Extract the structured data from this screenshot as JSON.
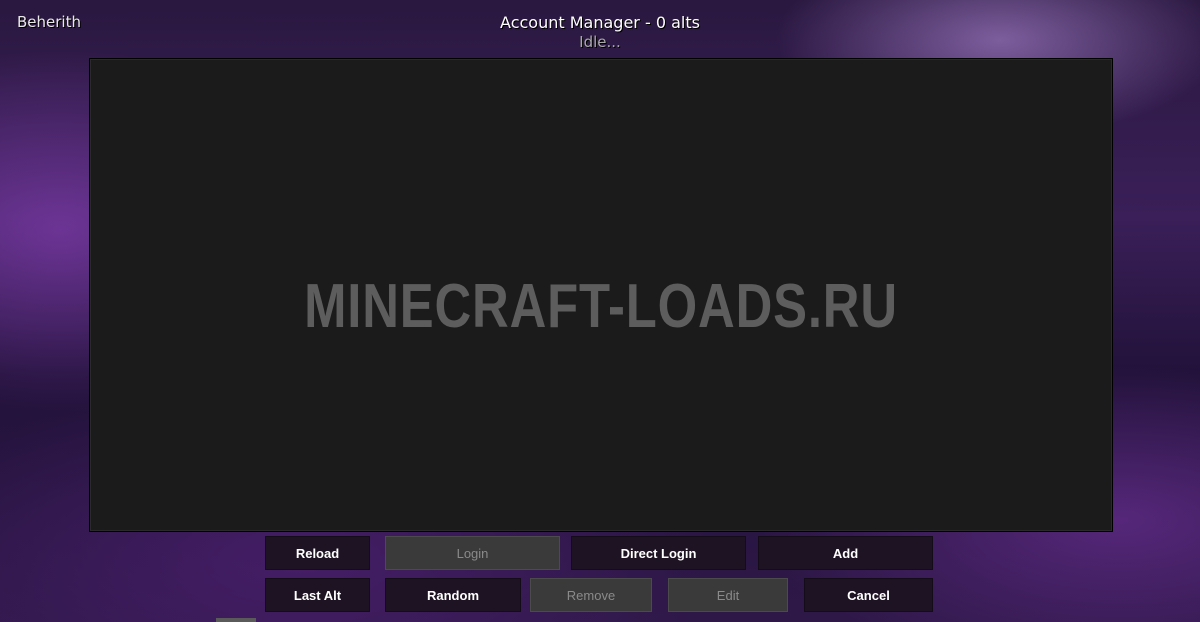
{
  "client_name": "Beherith",
  "header": {
    "title": "Account Manager - 0 alts",
    "status": "Idle..."
  },
  "watermark": "MINECRAFT-LOADS.RU",
  "buttons": {
    "reload": "Reload",
    "login": "Login",
    "direct_login": "Direct Login",
    "add": "Add",
    "last_alt": "Last Alt",
    "random": "Random",
    "remove": "Remove",
    "edit": "Edit",
    "cancel": "Cancel"
  },
  "colors": {
    "button_active": "#1e1322",
    "button_disabled": "#3a3a3a",
    "list_background": "#1b1b1b"
  }
}
